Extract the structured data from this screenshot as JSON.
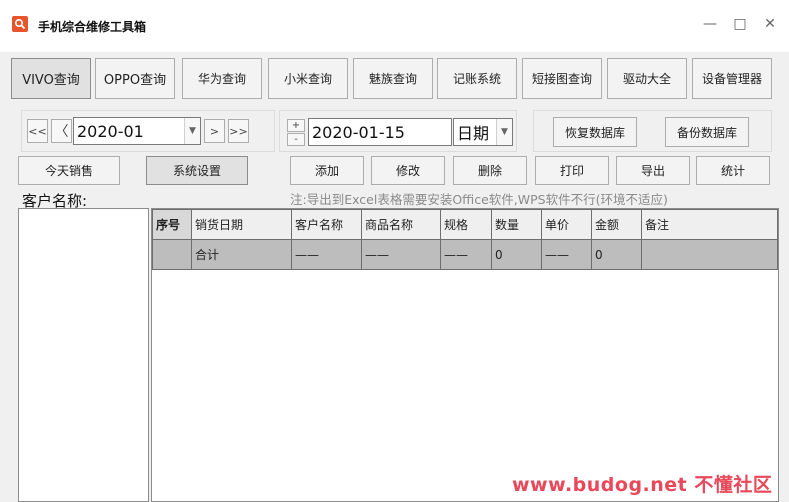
{
  "window": {
    "title": "手机综合维修工具箱",
    "minimize": "—",
    "maximize": "□",
    "close": "✕"
  },
  "toolbar": [
    "VIVO查询",
    "OPPO查询",
    "华为查询",
    "小米查询",
    "魅族查询",
    "记账系统",
    "短接图查询",
    "驱动大全",
    "设备管理器"
  ],
  "month_nav": {
    "first": "<<",
    "prev": "〈",
    "month": "2020-01",
    "next": ">",
    "last": ">>"
  },
  "date_picker": {
    "inc": "+",
    "dec": "-",
    "date": "2020-01-15",
    "mode": "日期"
  },
  "db": {
    "restore": "恢复数据库",
    "backup": "备份数据库"
  },
  "actions": {
    "today_sales": "今天销售",
    "settings": "系统设置",
    "add": "添加",
    "edit": "修改",
    "delete": "删除",
    "print": "打印",
    "export": "导出",
    "stats": "统计"
  },
  "hint": "注:导出到Excel表格需要安装Office软件,WPS软件不行(环境不适应)",
  "customer_label": "客户名称:",
  "table": {
    "columns": [
      "序号",
      "销货日期",
      "客户名称",
      "商品名称",
      "规格",
      "数量",
      "单价",
      "金额",
      "备注"
    ],
    "total_row": [
      "",
      "合计",
      "——",
      "——",
      "——",
      "0",
      "——",
      "0",
      ""
    ]
  },
  "watermark": "www.budog.net 不懂社区"
}
